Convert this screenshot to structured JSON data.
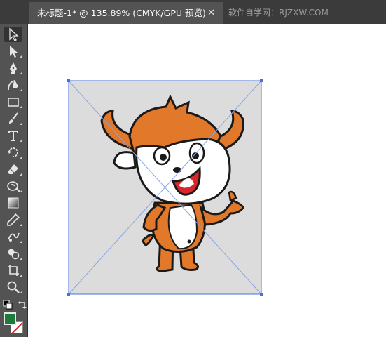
{
  "tabs": {
    "active_title": "未标题-1* @ 135.89% (CMYK/GPU 预览)",
    "close_glyph": "✕",
    "watermark": "软件自学网：RJZXW.COM"
  },
  "tools": [
    {
      "name": "selection-tool",
      "icon": "arrow-black"
    },
    {
      "name": "direct-selection-tool",
      "icon": "arrow-white"
    },
    {
      "name": "pen-tool",
      "icon": "pen-icon"
    },
    {
      "name": "curvature-tool",
      "icon": "curvature-icon"
    },
    {
      "name": "rectangle-tool",
      "icon": "rectangle-icon"
    },
    {
      "name": "paintbrush-tool",
      "icon": "brush-icon"
    },
    {
      "name": "type-tool",
      "icon": "type-icon"
    },
    {
      "name": "rotate-tool",
      "icon": "rotate-icon"
    },
    {
      "name": "eraser-tool",
      "icon": "eraser-icon"
    },
    {
      "name": "warp-tool",
      "icon": "warp-icon"
    },
    {
      "name": "gradient-tool",
      "icon": "gradient-icon"
    },
    {
      "name": "eyedropper-tool",
      "icon": "eyedropper-icon"
    },
    {
      "name": "blend-tool",
      "icon": "blend-icon"
    },
    {
      "name": "shape-builder-tool",
      "icon": "shape-builder-icon"
    },
    {
      "name": "artboard-tool",
      "icon": "artboard-icon"
    },
    {
      "name": "zoom-tool",
      "icon": "zoom-icon"
    }
  ],
  "colors": {
    "fill": "#1e7a3c",
    "stroke": "none",
    "character_orange": "#e1782a",
    "placed_image_bg": "#dcdcdc",
    "selection": "#4a6fd6"
  }
}
